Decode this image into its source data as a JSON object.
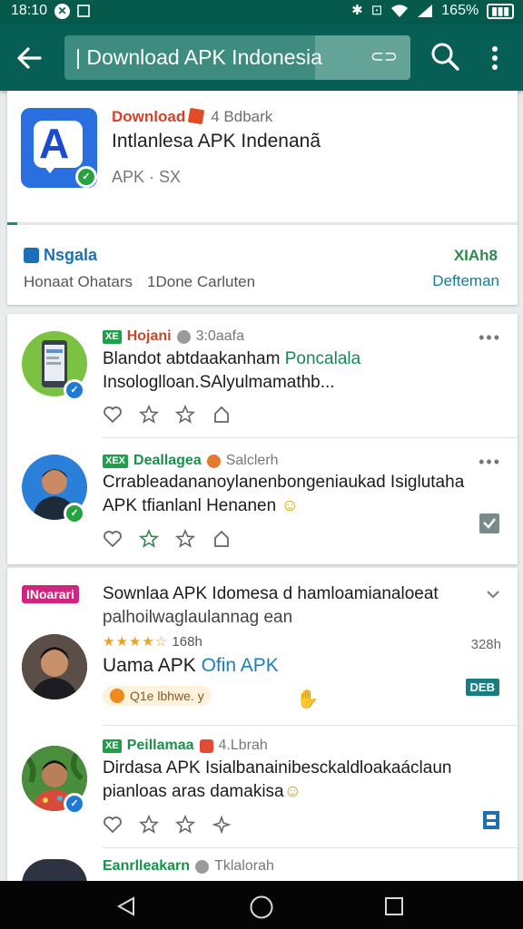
{
  "status_bar": {
    "time": "18:10",
    "battery": "165%"
  },
  "toolbar": {
    "search_text": "| Download APK Indonesia"
  },
  "app_card": {
    "title": "Download",
    "title_meta": "4 Bdbark",
    "name": "Intlanlesa APK Indenanã",
    "meta": "APK · SX",
    "progress_fraction": 0.02,
    "tag_label": "Nsgala",
    "sub_left": "Honaat Ohatars",
    "sub_right": "1Done Carluten",
    "right_label_1": "XIAh8",
    "right_label_2": "Defteman"
  },
  "posts": [
    {
      "badge": "XE",
      "name": "Hojani",
      "meta": "3:0aafa",
      "line1_prefix": "Blandot abtdaakanham ",
      "line1_accent": "Poncalala",
      "line2": "Insologlloan.SAlyulmamathb..."
    },
    {
      "badge": "XEX",
      "name": "Deallagea",
      "meta": "Salclerh",
      "line1": "Crrableadananoylanenbongeniaukad Isiglutaha",
      "line2": "APK tfianlanl Henanen"
    }
  ],
  "feature_card": {
    "badge": "INoarari",
    "title_line1": "Sownlaa APK Idomesa d hamloamianaloeat",
    "title_line2": "palhoilwaglaulannag ean",
    "rating_text": "168h",
    "time": "328h",
    "name_prefix": "Uama APK ",
    "name_accent": "Ofin APK",
    "pill": "Q1e lbhwe. y",
    "tag": "DEB"
  },
  "post3": {
    "badge": "XE",
    "name": "Peillamaa",
    "meta": "4.Lbrah",
    "line1": "Dirdasa APK Isialbanainibesckaldloakaáclaun",
    "line2": "pianloas aras damakisa"
  },
  "post4": {
    "name": "Eanrlleakarn",
    "meta": "Tklalorah"
  },
  "colors": {
    "toolbar": "#075e54",
    "accent_green": "#1ea04a",
    "accent_blue": "#1d7fb8"
  }
}
